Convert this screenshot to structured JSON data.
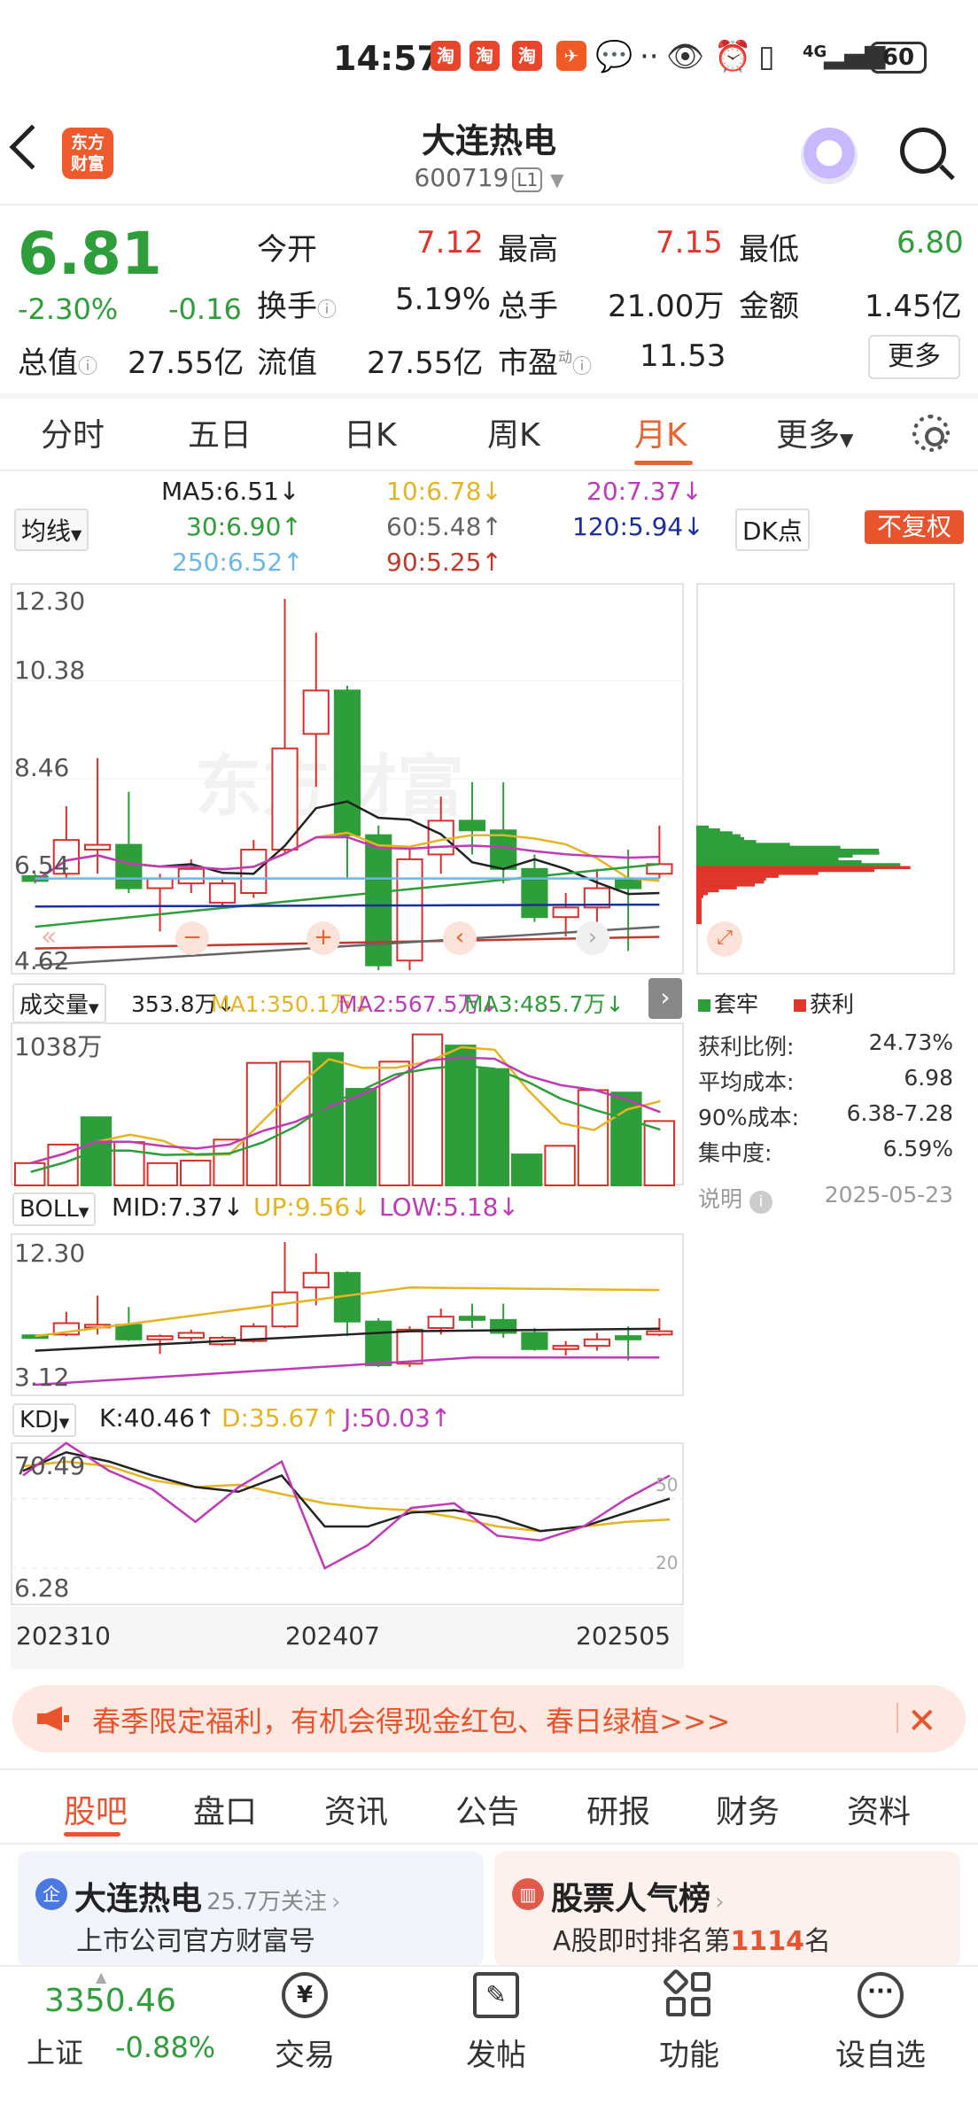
{
  "status_bar": {
    "time": "14:57",
    "network": "4G",
    "battery": "60"
  },
  "header": {
    "title": "大连热电",
    "code": "600719",
    "level": "L1",
    "app_logo": "东方财富"
  },
  "quote": {
    "price": "6.81",
    "change_pct": "-2.30%",
    "change": "-0.16",
    "rows": [
      [
        {
          "k": "今开",
          "v": "7.12",
          "c": "red"
        },
        {
          "k": "最高",
          "v": "7.15",
          "c": "red"
        },
        {
          "k": "最低",
          "v": "6.80",
          "c": "green"
        }
      ],
      [
        {
          "k": "换手",
          "v": "5.19%",
          "c": "dark"
        },
        {
          "k": "总手",
          "v": "21.00万",
          "c": "dark"
        },
        {
          "k": "金额",
          "v": "1.45亿",
          "c": "dark"
        }
      ],
      [
        {
          "k": "总值",
          "v": "27.55亿",
          "c": "dark"
        },
        {
          "k": "流值",
          "v": "27.55亿",
          "c": "dark"
        },
        {
          "k": "市盈",
          "v": "11.53",
          "c": "dark"
        }
      ]
    ],
    "more": "更多",
    "pe_sup": "动"
  },
  "period_tabs": [
    "分时",
    "五日",
    "日K",
    "周K",
    "月K",
    "更多"
  ],
  "active_period": "月K",
  "ma_legend": {
    "selector": "均线",
    "items": [
      {
        "label": "MA5:6.51↓",
        "color": "#222"
      },
      {
        "label": "10:6.78↓",
        "color": "#e6b422"
      },
      {
        "label": "20:7.37↓",
        "color": "#c03ab8"
      },
      {
        "label": "30:6.90↑",
        "color": "#2e9e3a"
      },
      {
        "label": "60:5.48↑",
        "color": "#666"
      },
      {
        "label": "120:5.94↓",
        "color": "#1c2e9e"
      },
      {
        "label": "250:6.52↑",
        "color": "#6bb8e8"
      },
      {
        "label": "90:5.25↑",
        "color": "#c0392b"
      }
    ],
    "dk_button": "DK点",
    "fq_button": "不复权"
  },
  "kline": {
    "y_labels": [
      "12.30",
      "10.38",
      "8.46",
      "6.54",
      "4.62"
    ],
    "candles": [
      {
        "o": 6.55,
        "c": 6.45,
        "h": 6.6,
        "l": 6.4
      },
      {
        "o": 6.6,
        "c": 7.3,
        "h": 8.0,
        "l": 6.5
      },
      {
        "o": 7.1,
        "c": 7.2,
        "h": 9.0,
        "l": 6.6
      },
      {
        "o": 7.2,
        "c": 6.3,
        "h": 8.3,
        "l": 6.2
      },
      {
        "o": 6.3,
        "c": 6.5,
        "h": 6.6,
        "l": 5.4
      },
      {
        "o": 6.4,
        "c": 6.7,
        "h": 6.9,
        "l": 6.2
      },
      {
        "o": 6.0,
        "c": 6.4,
        "h": 6.5,
        "l": 5.9
      },
      {
        "o": 6.2,
        "c": 7.1,
        "h": 7.3,
        "l": 6.1
      },
      {
        "o": 7.1,
        "c": 9.2,
        "h": 12.3,
        "l": 7.0
      },
      {
        "o": 9.5,
        "c": 10.4,
        "h": 11.6,
        "l": 8.4
      },
      {
        "o": 10.4,
        "c": 7.4,
        "h": 10.5,
        "l": 6.5
      },
      {
        "o": 7.4,
        "c": 4.7,
        "h": 7.6,
        "l": 4.6
      },
      {
        "o": 4.8,
        "c": 6.9,
        "h": 7.1,
        "l": 4.6
      },
      {
        "o": 7.0,
        "c": 7.7,
        "h": 8.2,
        "l": 6.6
      },
      {
        "o": 7.7,
        "c": 7.5,
        "h": 8.5,
        "l": 7.0
      },
      {
        "o": 7.5,
        "c": 6.7,
        "h": 8.5,
        "l": 6.4
      },
      {
        "o": 6.7,
        "c": 5.7,
        "h": 7.0,
        "l": 5.6
      },
      {
        "o": 5.7,
        "c": 5.9,
        "h": 6.2,
        "l": 5.3
      },
      {
        "o": 5.9,
        "c": 6.3,
        "h": 6.7,
        "l": 5.6
      },
      {
        "o": 6.5,
        "c": 6.3,
        "h": 7.1,
        "l": 5.0
      },
      {
        "o": 6.6,
        "c": 6.8,
        "h": 7.6,
        "l": 6.5
      }
    ],
    "watermark": "东方财富"
  },
  "volume": {
    "selector": "成交量",
    "legend": [
      {
        "label": "353.8万↓",
        "color": "#222"
      },
      {
        "label": "MA1:350.1万↓",
        "color": "#e6b422"
      },
      {
        "label": "MA2:567.5万↓",
        "color": "#c03ab8"
      },
      {
        "label": "MA3:485.7万↓",
        "color": "#2e9e3a"
      }
    ],
    "max_label": "1038万",
    "values": [
      180,
      330,
      550,
      350,
      180,
      200,
      370,
      990,
      1000,
      1070,
      780,
      1000,
      1220,
      1130,
      940,
      250,
      320,
      770,
      750,
      520
    ]
  },
  "boll": {
    "selector": "BOLL",
    "legend": [
      {
        "label": "MID:7.37↓",
        "color": "#222"
      },
      {
        "label": "UP:9.56↓",
        "color": "#e6b422"
      },
      {
        "label": "LOW:5.18↓",
        "color": "#c03ab8"
      }
    ],
    "y_labels": [
      "12.30",
      "3.12"
    ]
  },
  "kdj": {
    "selector": "KDJ",
    "legend": [
      {
        "label": "K:40.46↑",
        "color": "#222"
      },
      {
        "label": "D:35.67↑",
        "color": "#e6b422"
      },
      {
        "label": "J:50.03↑",
        "color": "#c03ab8"
      }
    ],
    "y_labels": [
      "70.49",
      "6.28"
    ],
    "ref_labels": [
      "50",
      "20"
    ],
    "x_labels": [
      "202310",
      "202407",
      "202505"
    ]
  },
  "chips": {
    "legend": [
      {
        "label": "套牢",
        "color": "#2e9e3a"
      },
      {
        "label": "获利",
        "color": "#e0352b"
      }
    ],
    "stats": [
      {
        "k": "获利比例:",
        "v": "24.73%"
      },
      {
        "k": "平均成本:",
        "v": "6.98"
      },
      {
        "k": "90%成本:",
        "v": "6.38-7.28"
      },
      {
        "k": "集中度:",
        "v": "6.59%"
      }
    ],
    "note": "说明",
    "date": "2025-05-23"
  },
  "banner": {
    "text": "春季限定福利，有机会得现金红包、春日绿植>>>"
  },
  "bottom_tabs": [
    "股吧",
    "盘口",
    "资讯",
    "公告",
    "研报",
    "财务",
    "资料"
  ],
  "cards": [
    {
      "title": "大连热电",
      "sub": "25.7万关注",
      "desc": "上市公司官方财富号",
      "badge": "企"
    },
    {
      "title": "股票人气榜",
      "desc_pre": "A股即时排名第",
      "rank": "1114",
      "desc_post": "名"
    }
  ],
  "navbar": {
    "index_value": "3350.46",
    "index_name": "上证",
    "index_change": "-0.88%",
    "items": [
      "交易",
      "发帖",
      "功能",
      "设自选"
    ]
  }
}
